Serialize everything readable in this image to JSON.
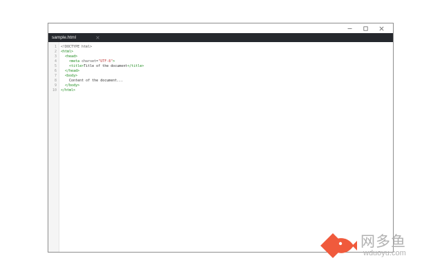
{
  "window": {
    "tab": {
      "label": "sample.html"
    },
    "controls": {
      "minimize_icon": "minimize-icon",
      "maximize_icon": "maximize-icon",
      "close_icon": "close-icon"
    }
  },
  "editor": {
    "line_numbers": [
      "1",
      "2",
      "3",
      "4",
      "5",
      "6",
      "7",
      "8",
      "9",
      "10"
    ],
    "lines": [
      [
        {
          "t": "<!DOCTYPE html>",
          "c": "doctype"
        }
      ],
      [
        {
          "t": "<html>",
          "c": "tag"
        }
      ],
      [
        {
          "t": "  ",
          "c": "text"
        },
        {
          "t": "<head>",
          "c": "tag"
        }
      ],
      [
        {
          "t": "    ",
          "c": "text"
        },
        {
          "t": "<meta ",
          "c": "tag"
        },
        {
          "t": "charset=",
          "c": "attr"
        },
        {
          "t": "\"UTF-8\"",
          "c": "str"
        },
        {
          "t": ">",
          "c": "tag"
        }
      ],
      [
        {
          "t": "    ",
          "c": "text"
        },
        {
          "t": "<title>",
          "c": "tag"
        },
        {
          "t": "Title of the document",
          "c": "text"
        },
        {
          "t": "</title>",
          "c": "tag"
        }
      ],
      [
        {
          "t": "  ",
          "c": "text"
        },
        {
          "t": "</head>",
          "c": "tag"
        }
      ],
      [
        {
          "t": "  ",
          "c": "text"
        },
        {
          "t": "<body>",
          "c": "tag"
        }
      ],
      [
        {
          "t": "    Content of the document...",
          "c": "text"
        }
      ],
      [
        {
          "t": "  ",
          "c": "text"
        },
        {
          "t": "</body>",
          "c": "tag"
        }
      ],
      [
        {
          "t": "</html>",
          "c": "tag"
        }
      ]
    ]
  },
  "watermark": {
    "brand_cn": "网多鱼",
    "brand_url": "wduoyu.com",
    "logo_icon": "fish-logo-icon"
  },
  "colors": {
    "tabbar_bg": "#25282d",
    "tag": "#1a8a1a",
    "string": "#c23a3a",
    "logo": "#f05a3c"
  }
}
